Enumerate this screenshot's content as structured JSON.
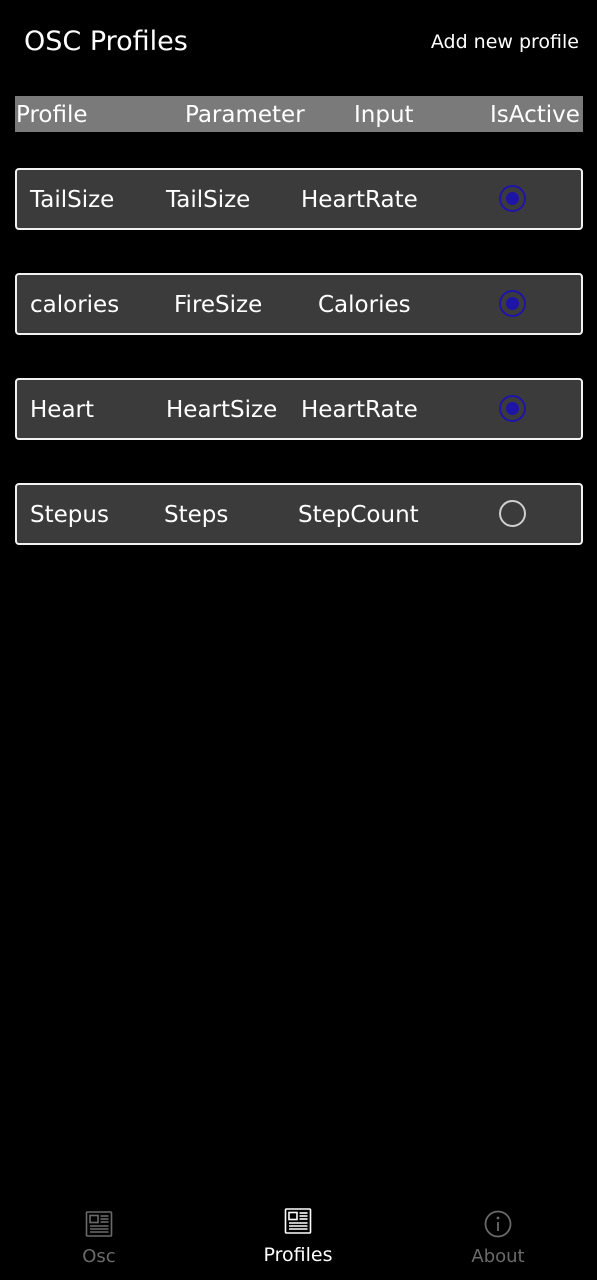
{
  "app": {
    "title": "OSC Profiles",
    "add_profile_label": "Add new profile"
  },
  "table": {
    "headers": [
      "Profile",
      "Parameter",
      "Input",
      "IsActive"
    ],
    "rows": [
      {
        "profile": "TailSize",
        "parameter": "TailSize",
        "input": "HeartRate",
        "active": true
      },
      {
        "profile": "calories",
        "parameter": "FireSize",
        "input": "Calories",
        "active": true
      },
      {
        "profile": "Heart",
        "parameter": "HeartSize",
        "input": "HeartRate",
        "active": true
      },
      {
        "profile": "Stepus",
        "parameter": "Steps",
        "input": "StepCount",
        "active": false
      }
    ]
  },
  "nav": {
    "items": [
      {
        "label": "Osc",
        "icon": "newspaper-icon",
        "active": false
      },
      {
        "label": "Profiles",
        "icon": "newspaper-icon",
        "active": true
      },
      {
        "label": "About",
        "icon": "info-icon",
        "active": false
      }
    ]
  },
  "colors": {
    "background": "#000000",
    "header_bar": "#7a7a7a",
    "card": "#3b3b3b",
    "radio_active": "#1f14a8",
    "nav_inactive": "#6a6a6a"
  }
}
